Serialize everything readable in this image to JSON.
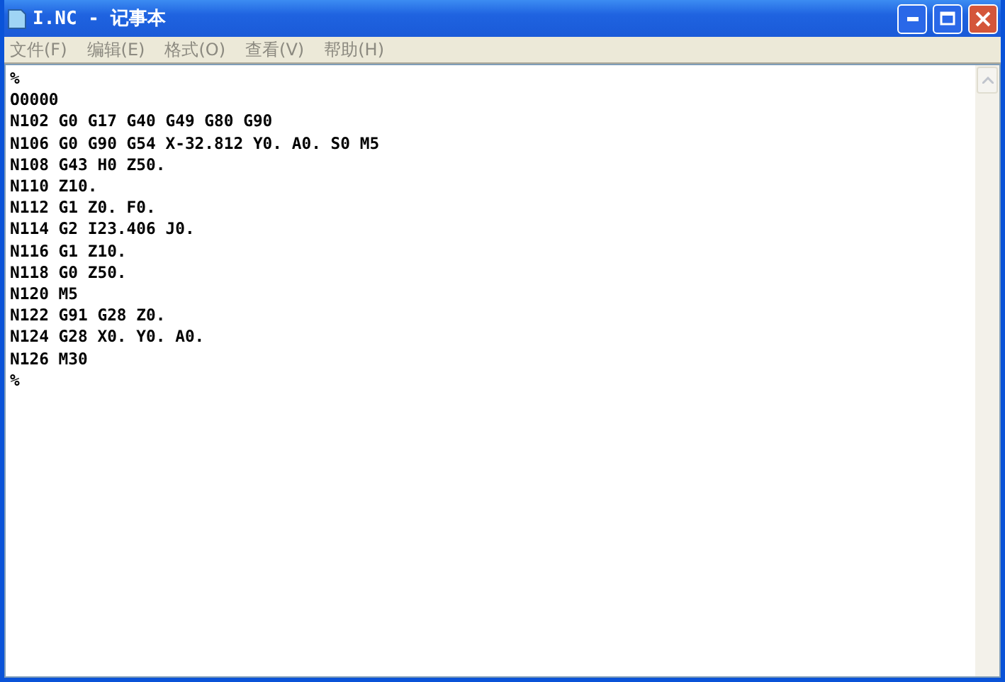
{
  "window": {
    "title": "I.NC - 记事本"
  },
  "menu": [
    "文件(F)",
    "编辑(E)",
    "格式(O)",
    "查看(V)",
    "帮助(H)"
  ],
  "editor": {
    "lines": [
      "%",
      "O0000",
      "N102 G0 G17 G40 G49 G80 G90",
      "N106 G0 G90 G54 X-32.812 Y0. A0. S0 M5",
      "N108 G43 H0 Z50.",
      "N110 Z10.",
      "N112 G1 Z0. F0.",
      "N114 G2 I23.406 J0.",
      "N116 G1 Z10.",
      "N118 G0 Z50.",
      "N120 M5",
      "N122 G91 G28 Z0.",
      "N124 G28 X0. Y0. A0.",
      "N126 M30",
      "%"
    ]
  }
}
